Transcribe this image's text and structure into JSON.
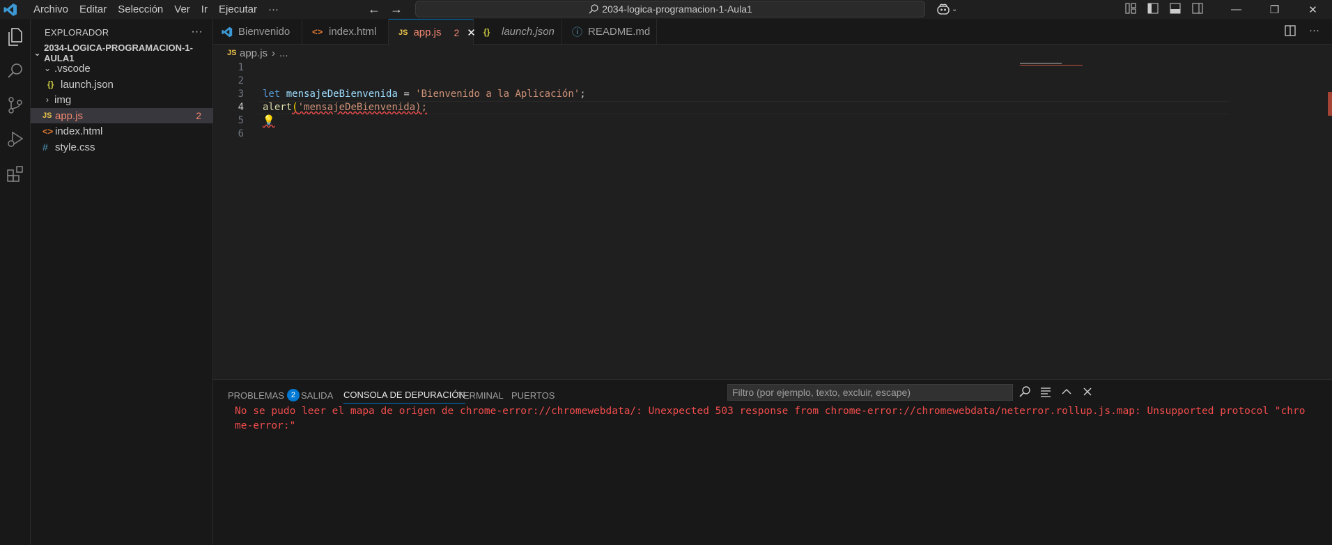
{
  "titlebar": {
    "menu": [
      "Archivo",
      "Editar",
      "Selección",
      "Ver",
      "Ir",
      "Ejecutar",
      "···"
    ],
    "search_text": "2034-logica-programacion-1-Aula1"
  },
  "sidebar": {
    "header": "EXPLORADOR",
    "more": "···",
    "root": "2034-LOGICA-PROGRAMACION-1-AULA1",
    "items": [
      {
        "label": ".vscode"
      },
      {
        "label": "launch.json",
        "icon": "{}"
      },
      {
        "label": "img"
      },
      {
        "label": "app.js",
        "icon": "JS",
        "badge": "2"
      },
      {
        "label": "index.html",
        "icon": "<>"
      },
      {
        "label": "style.css",
        "icon": "#"
      }
    ]
  },
  "tabs": [
    {
      "label": "Bienvenido"
    },
    {
      "label": "index.html",
      "icon": "<>"
    },
    {
      "label": "app.js",
      "icon": "JS",
      "badge": "2",
      "close": "✕"
    },
    {
      "label": "launch.json",
      "icon": "{}"
    },
    {
      "label": "README.md",
      "icon": "ⓘ"
    }
  ],
  "breadcrumb": {
    "file": "app.js",
    "icon": "JS",
    "sep": "›",
    "rest": "..."
  },
  "editor": {
    "line_numbers": [
      "1",
      "2",
      "3",
      "4",
      "5",
      "6"
    ],
    "line3": {
      "kw": "let",
      "var": "mensajeDeBienvenida",
      "op": " = ",
      "str": "'Bienvenido a la Aplicación'",
      "end": ";"
    },
    "line4": {
      "fn": "alert",
      "open": "(",
      "str": "'mensajeDeBienvenida);",
      "end": ""
    }
  },
  "panel": {
    "tabs": [
      {
        "label": "PROBLEMAS",
        "badge": "2"
      },
      {
        "label": "SALIDA"
      },
      {
        "label": "CONSOLA DE DEPURACIÓN"
      },
      {
        "label": "TERMINAL"
      },
      {
        "label": "PUERTOS"
      }
    ],
    "filter_placeholder": "Filtro (por ejemplo, texto, excluir, escape)",
    "output": "No se pudo leer el mapa de origen de chrome-error://chromewebdata/: Unexpected 503 response from chrome-error://chromewebdata/neterror.rollup.js.map: Unsupported protocol \"chrome-error:\""
  },
  "colors": {
    "accent": "#0078d4",
    "error": "#f14c4c",
    "background": "#1f1f1f",
    "sidebar": "#181818"
  },
  "icons": [
    "vscode-logo-icon",
    "files-icon",
    "search-icon",
    "source-control-icon",
    "run-debug-icon",
    "extensions-icon",
    "copilot-icon",
    "lightbulb-icon"
  ]
}
